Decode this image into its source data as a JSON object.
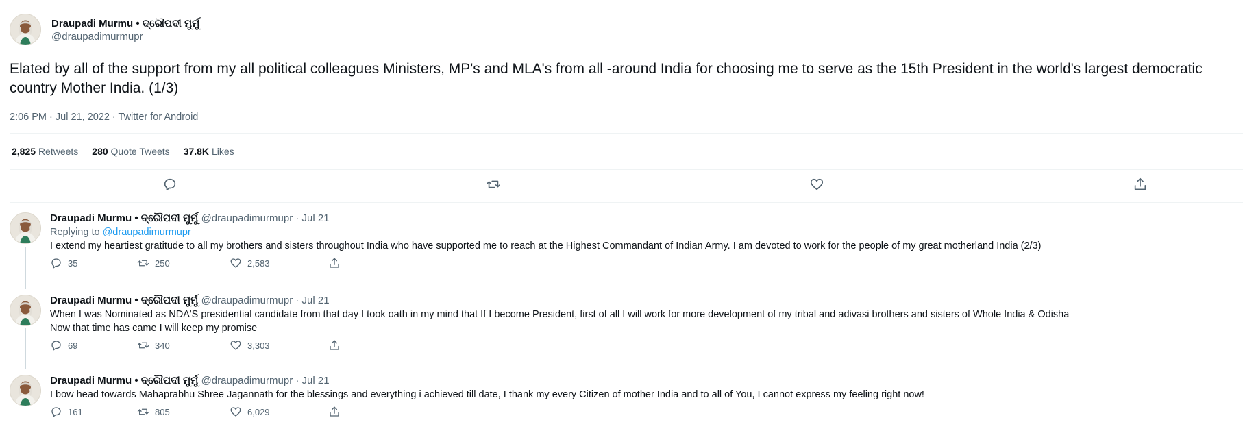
{
  "main_tweet": {
    "author_name": "Draupadi Murmu • ଦ୍ରୌପଦୀ ମୁର୍ମୁ",
    "handle": "@draupadimurmupr",
    "text": "Elated by all of the support from my all political colleagues Ministers, MP's and MLA's from all -around India for choosing me to serve as the 15th President in the world's largest democratic country Mother India. (1/3)",
    "timestamp": "2:06 PM · Jul 21, 2022 · Twitter for Android",
    "stats": {
      "retweets_count": "2,825",
      "retweets_label": "Retweets",
      "quotes_count": "280",
      "quotes_label": "Quote Tweets",
      "likes_count": "37.8K",
      "likes_label": "Likes"
    },
    "actions": [
      "reply-icon",
      "retweet-icon",
      "like-icon",
      "share-icon"
    ]
  },
  "replies": [
    {
      "author_name": "Draupadi Murmu • ଦ୍ରୌପଦୀ ମୁର୍ମୁ",
      "handle_date": "@draupadimurmupr · Jul 21",
      "replying_label": "Replying to",
      "replying_handle": "@draupadimurmupr",
      "text": "I extend my heartiest gratitude to all my brothers and sisters throughout India who have supported me to reach at the Highest Commandant of Indian Army. I am devoted to work for the people of my great motherland India (2/3)",
      "replies": "35",
      "retweets": "250",
      "likes": "2,583"
    },
    {
      "author_name": "Draupadi Murmu • ଦ୍ରୌପଦୀ ମୁର୍ମୁ",
      "handle_date": "@draupadimurmupr · Jul 21",
      "text_line1": "When I was Nominated as NDA'S presidential candidate from that day I took oath in my mind that If I become President, first of all I will work for more development of my tribal and adivasi brothers and sisters of Whole India & Odisha",
      "text_line2": "Now that time has came I will keep my promise",
      "replies": "69",
      "retweets": "340",
      "likes": "3,303"
    },
    {
      "author_name": "Draupadi Murmu • ଦ୍ରୌପଦୀ ମୁର୍ମୁ",
      "handle_date": "@draupadimurmupr · Jul 21",
      "text": "I bow head towards Mahaprabhu Shree Jagannath for the blessings and everything i achieved till date, I thank my every Citizen of mother India and to all of You, I cannot express my feeling right now!",
      "replies": "161",
      "retweets": "805",
      "likes": "6,029"
    }
  ],
  "colors": {
    "text": "#0f1419",
    "secondary": "#536471",
    "link": "#1d9bf0",
    "divider": "#eff3f4"
  }
}
